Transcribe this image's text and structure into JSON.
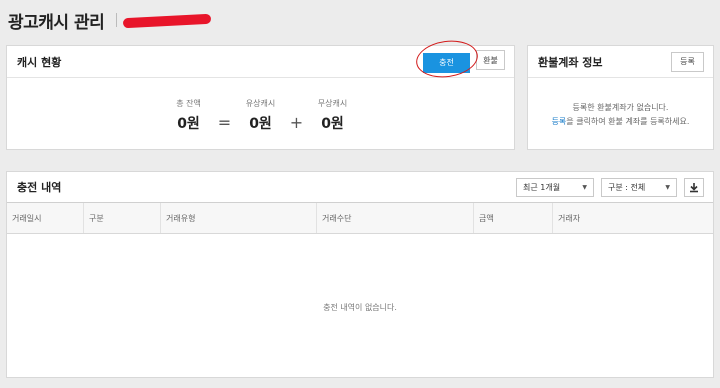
{
  "header": {
    "title": "광고캐시 관리",
    "account_id": "10"
  },
  "cash_status": {
    "title": "캐시 현황",
    "charge_button": "충전",
    "refund_button": "환불",
    "total_label": "총 잔액",
    "total_value": "0원",
    "paid_label": "유상캐시",
    "paid_value": "0원",
    "free_label": "무상캐시",
    "free_value": "0원",
    "equals": "=",
    "plus": "+"
  },
  "refund_account": {
    "title": "환불계좌 정보",
    "register_button": "등록",
    "message_line1": "등록한 환불계좌가 없습니다.",
    "message_link": "등록",
    "message_line2_rest": "을 클릭하여 환불 계좌를 등록하세요."
  },
  "history": {
    "title": "충전 내역",
    "period_select": "최근 1개월",
    "type_select": "구분 : 전체",
    "columns": [
      "거래일시",
      "구분",
      "거래유형",
      "거래수단",
      "금액",
      "거래자"
    ],
    "empty_message": "충전 내역이 없습니다."
  }
}
